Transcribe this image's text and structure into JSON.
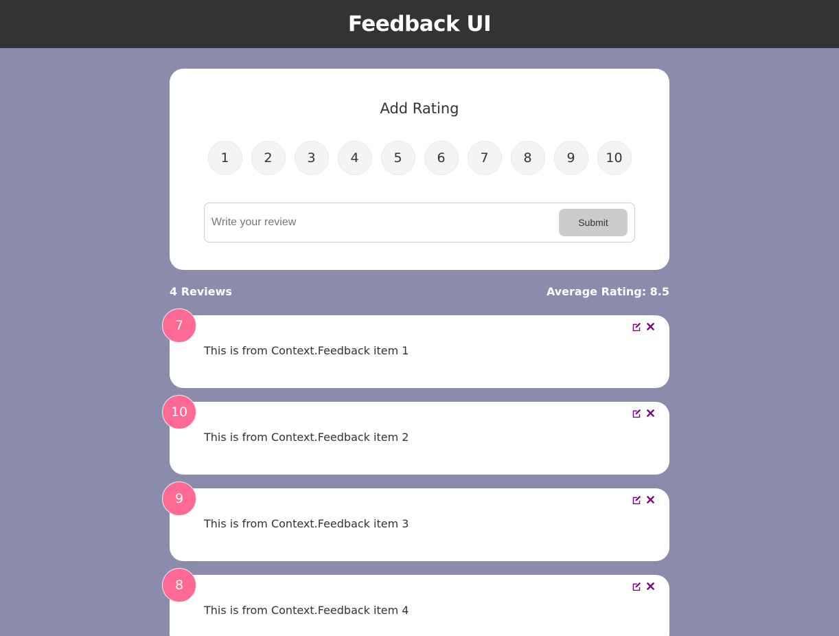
{
  "header": {
    "title": "Feedback UI"
  },
  "form": {
    "title": "Add Rating",
    "ratings": [
      "1",
      "2",
      "3",
      "4",
      "5",
      "6",
      "7",
      "8",
      "9",
      "10"
    ],
    "input_placeholder": "Write your review",
    "submit_label": "Submit"
  },
  "stats": {
    "review_count": "4 Reviews",
    "average": "Average Rating: 8.5"
  },
  "feedback": [
    {
      "rating": "7",
      "text": "This is from Context.Feedback item 1"
    },
    {
      "rating": "10",
      "text": "This is from Context.Feedback item 2"
    },
    {
      "rating": "9",
      "text": "This is from Context.Feedback item 3"
    },
    {
      "rating": "8",
      "text": "This is from Context.Feedback item 4"
    }
  ],
  "icons": {
    "edit": "edit-icon",
    "delete": "close-icon"
  },
  "colors": {
    "background": "#8b8bab",
    "header": "#333333",
    "rating_badge": "#ff6a95",
    "action_icon": "#800080"
  }
}
